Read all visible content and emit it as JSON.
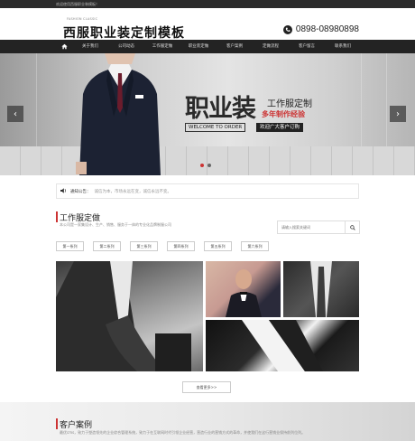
{
  "topbar": {
    "text": "欢迎使用西服职业装模板！"
  },
  "header": {
    "logo_sub": "FASHION CLASSIC",
    "logo_main": "西服职业装定制模板",
    "phone": "0898-08980898",
    "phone_icon": "phone-icon"
  },
  "nav": {
    "home_icon": "home-icon",
    "items": [
      "关于我们",
      "公司动态",
      "工作服定做",
      "职业装定做",
      "客户案例",
      "定做流程",
      "客户留言",
      "联系我们"
    ]
  },
  "banner": {
    "big_text": "职业装",
    "title": "工作服定制",
    "subtitle": "多年制作经验",
    "welcome": "WELCOME TO ORDER",
    "cta": "欢迎广大客户订购",
    "prev_icon": "chevron-left-icon",
    "next_icon": "chevron-right-icon",
    "active_slide": 2,
    "slide_count": 2
  },
  "notice": {
    "icon": "speaker-icon",
    "label": "通知公告：",
    "text": "诚信为本，市场永远在变，诚信永远不变。"
  },
  "section": {
    "title": "工作服定做",
    "desc": "本公司是一家集设计、生产、销售、服务于一体的专业化品牌制服公司"
  },
  "search": {
    "placeholder": "请输入搜索关键词",
    "icon": "search-icon"
  },
  "series": [
    "第一系列",
    "第二系列",
    "第三系列",
    "第四系列",
    "第五系列",
    "第六系列"
  ],
  "more_button": "查看更多>>",
  "cases": {
    "title": "客户案例",
    "desc": "最优cms，致力于塑造领先的企业综合管理系统，致力于在互联网时代引领企业经营，营造行业的营销方式的革命，并使我们在这行营销业保持前列位列。"
  },
  "colors": {
    "accent": "#cc3333",
    "nav_bg": "#232323",
    "topbar_bg": "#2b2b2b"
  }
}
